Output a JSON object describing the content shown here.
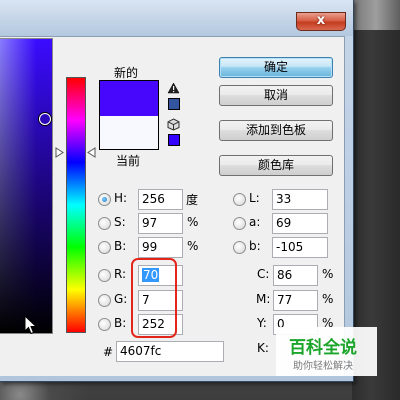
{
  "window": {
    "close_glyph": "x"
  },
  "swatches": {
    "new_label": "新的",
    "current_label": "当前",
    "new_color": "#4607fc",
    "current_color": "#f8f8ff",
    "gamut_swatch_color": "#3355a0",
    "websafe_swatch_color": "#3300ff"
  },
  "buttons": {
    "ok": "确定",
    "cancel": "取消",
    "add_to_swatches": "添加到色板",
    "color_libraries": "颜色库"
  },
  "hsb": [
    {
      "label": "H:",
      "value": "256",
      "unit": "度",
      "checked": true
    },
    {
      "label": "S:",
      "value": "97",
      "unit": "%",
      "checked": false
    },
    {
      "label": "B:",
      "value": "99",
      "unit": "%",
      "checked": false
    }
  ],
  "lab": [
    {
      "label": "L:",
      "value": "33"
    },
    {
      "label": "a:",
      "value": "69"
    },
    {
      "label": "b:",
      "value": "-105"
    }
  ],
  "rgb": [
    {
      "label": "R:",
      "value": "70"
    },
    {
      "label": "G:",
      "value": "7"
    },
    {
      "label": "B:",
      "value": "252"
    }
  ],
  "cmyk": [
    {
      "label": "C:",
      "value": "86",
      "unit": "%"
    },
    {
      "label": "M:",
      "value": "77",
      "unit": "%"
    },
    {
      "label": "Y:",
      "value": "0",
      "unit": "%"
    },
    {
      "label": "K:",
      "value": ""
    }
  ],
  "hex": {
    "label": "#",
    "value": "4607fc"
  },
  "watermark": {
    "title": "百科全说",
    "subtitle": "助你轻松解决"
  }
}
